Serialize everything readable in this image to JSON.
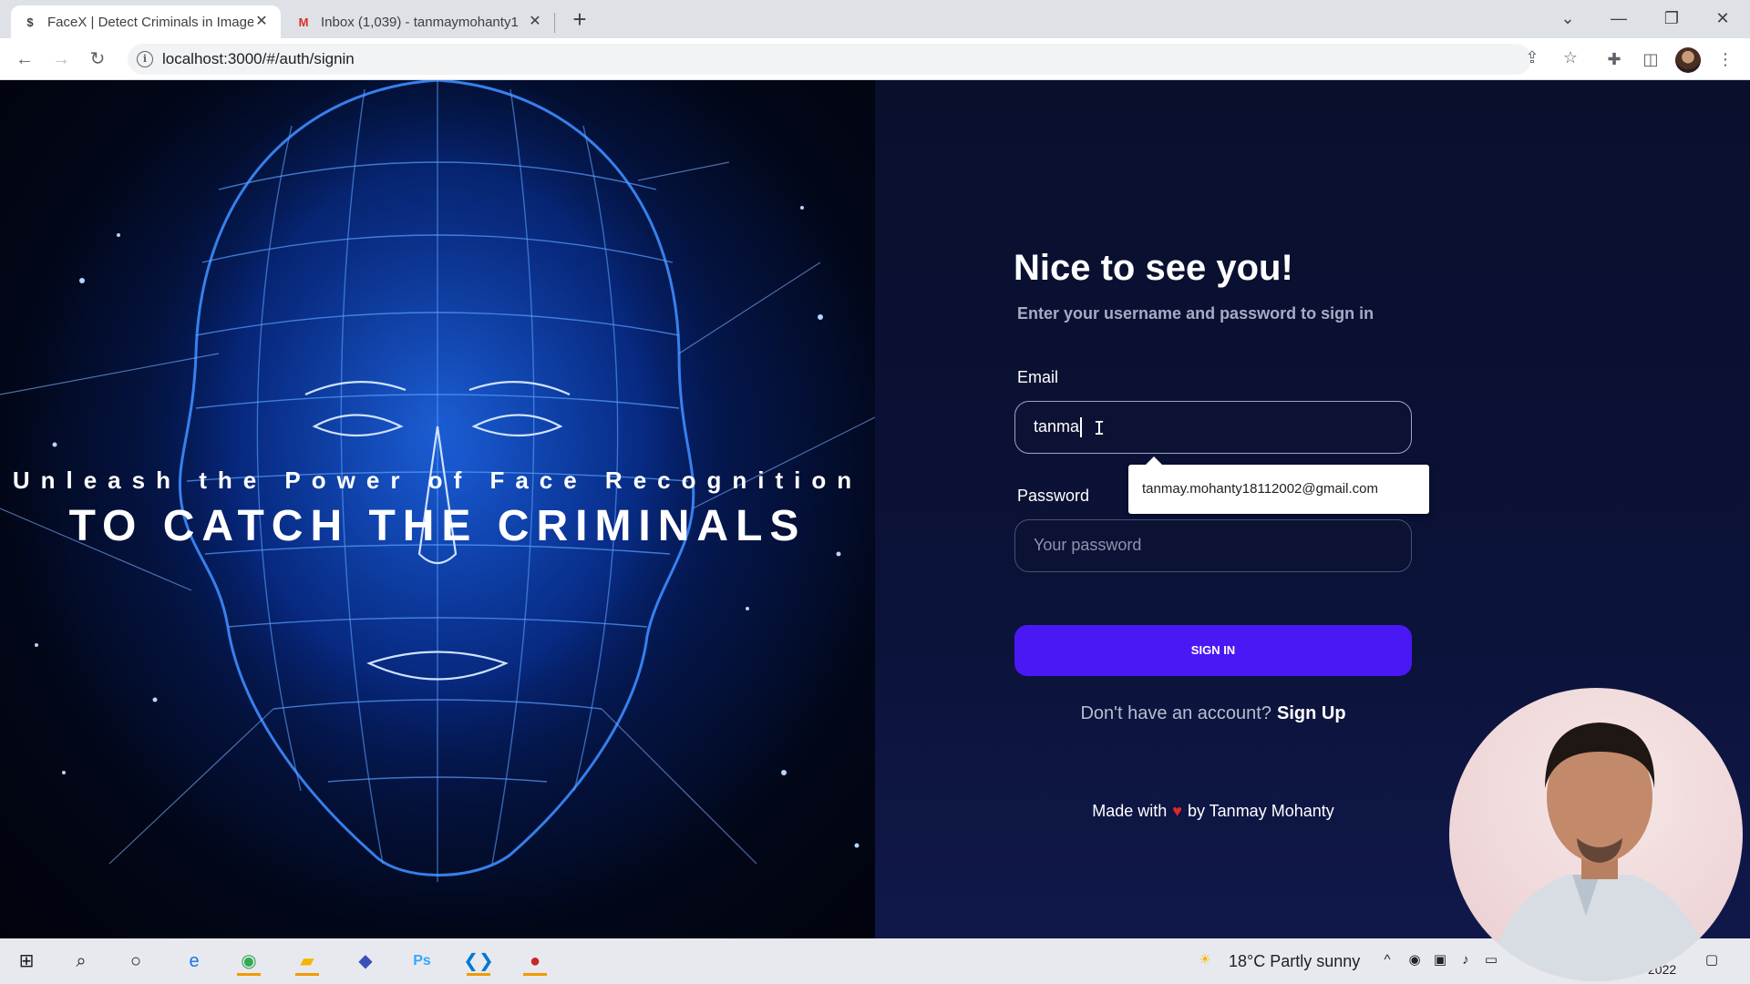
{
  "browser": {
    "tabs": [
      {
        "title": "FaceX | Detect Criminals in Image",
        "favicon": "$",
        "active": true
      },
      {
        "title": "Inbox (1,039) - tanmaymohanty1",
        "favicon": "M",
        "active": false
      }
    ],
    "url": "localhost:3000/#/auth/signin"
  },
  "hero": {
    "tagline": "Unleash the Power of Face Recognition",
    "headline": "TO CATCH THE CRIMINALS"
  },
  "signin": {
    "title": "Nice to see you!",
    "subtitle": "Enter your username and password to sign in",
    "email_label": "Email",
    "email_value": "tanma",
    "autocomplete_suggestion": "tanmay.mohanty18112002@gmail.com",
    "password_label": "Password",
    "password_placeholder": "Your password",
    "button_label": "SIGN IN",
    "signup_prompt": "Don't have an account?",
    "signup_link": "Sign Up",
    "footer_made_with": "Made with",
    "footer_by": "by Tanmay Mohanty"
  },
  "taskbar": {
    "weather": "18°C  Partly sunny",
    "clock_partial": "2022"
  },
  "colors": {
    "accent": "#4a18f5",
    "panel_bg": "#0a0f2c",
    "hero_glow": "#0b3ea8"
  }
}
